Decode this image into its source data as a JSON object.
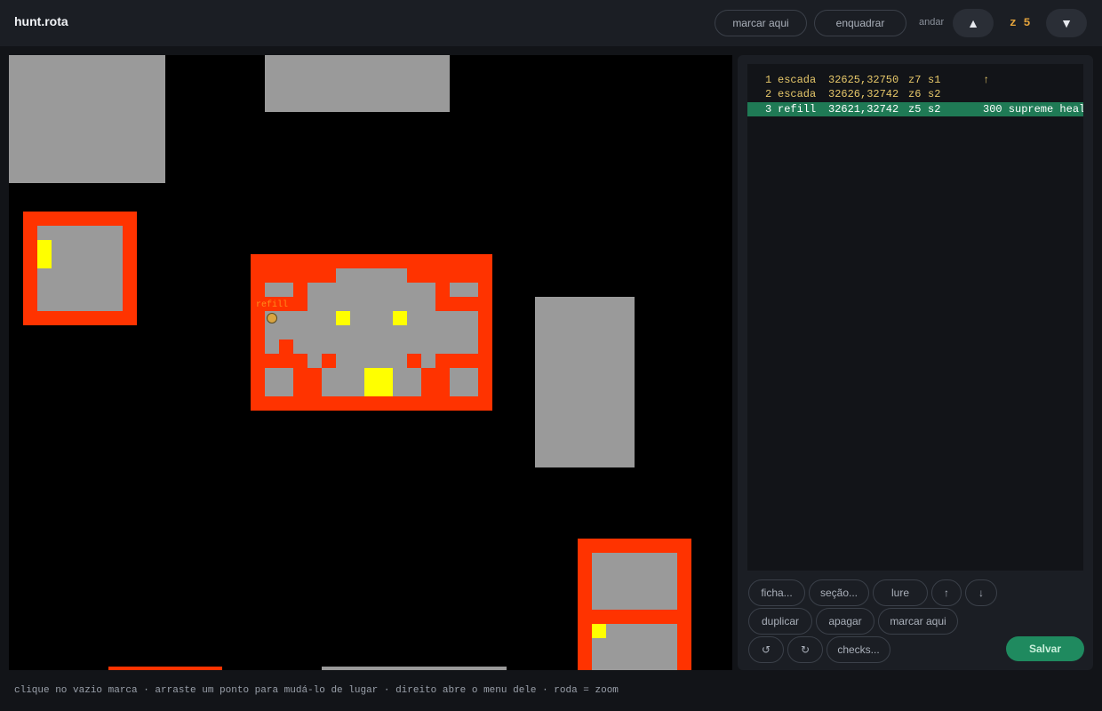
{
  "app": {
    "title": "hunt.rota"
  },
  "toolbar": {
    "mark_here": "marcar aqui",
    "frame": "enquadrar",
    "floor_label": "andar",
    "floor_up": "▲",
    "floor_value": "z 5",
    "floor_down": "▼"
  },
  "map": {
    "marker_label": "refill"
  },
  "route": {
    "rows": [
      {
        "num": "1",
        "type": "escada",
        "coords": "32625,32750",
        "z": "z7",
        "section": "s1",
        "note": "↑",
        "selected": false
      },
      {
        "num": "2",
        "type": "escada",
        "coords": "32626,32742",
        "z": "z6",
        "section": "s2",
        "note": "",
        "selected": false
      },
      {
        "num": "3",
        "type": "refill",
        "coords": "32621,32742",
        "z": "z5",
        "section": "s2",
        "note": "300 supreme heal",
        "selected": true
      }
    ]
  },
  "panel_buttons": {
    "sheet": "ficha...",
    "section": "seção...",
    "lure": "lure",
    "move_up": "↑",
    "move_down": "↓",
    "duplicate": "duplicar",
    "delete": "apagar",
    "mark_here": "marcar aqui",
    "undo": "↺",
    "redo": "↻",
    "checks": "checks...",
    "save": "Salvar"
  },
  "footer": {
    "hint": "clique no vazio marca · arraste um ponto para mudá-lo de lugar · direito abre o menu dele · roda = zoom"
  },
  "colors": {
    "wall": "#ff3300",
    "floor": "#9a9a9a",
    "special": "#ffff00",
    "accent": "#1f8a5f",
    "floor_text": "#e2a23b"
  }
}
